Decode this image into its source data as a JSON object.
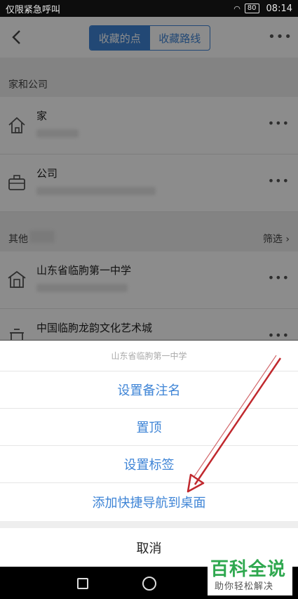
{
  "status_bar": {
    "carrier": "仅限紧急呼叫",
    "battery": "80",
    "time": "08:14"
  },
  "header": {
    "tabs": [
      {
        "label": "收藏的点",
        "active": true
      },
      {
        "label": "收藏路线",
        "active": false
      }
    ],
    "more": "•••"
  },
  "sections": {
    "home_work": {
      "label": "家和公司"
    },
    "others": {
      "label": "其他",
      "filter": "筛选"
    }
  },
  "rows": [
    {
      "title": "家",
      "icon": "home-icon"
    },
    {
      "title": "公司",
      "icon": "briefcase-icon"
    },
    {
      "title": "山东省临朐第一中学",
      "icon": "school-icon"
    },
    {
      "title": "中国临朐龙韵文化艺术城",
      "icon": "building-icon"
    }
  ],
  "row_more": "•••",
  "action_sheet": {
    "items": [
      "设置备注名",
      "置顶",
      "设置标签",
      "添加快捷导航到桌面"
    ],
    "cancel": "取消"
  },
  "watermark": {
    "title": "百科全说",
    "subtitle": "助你轻松解决"
  },
  "colors": {
    "accent": "#3e84d6",
    "annotation_arrow": "#c0282d",
    "watermark_green": "#2fa84f"
  }
}
